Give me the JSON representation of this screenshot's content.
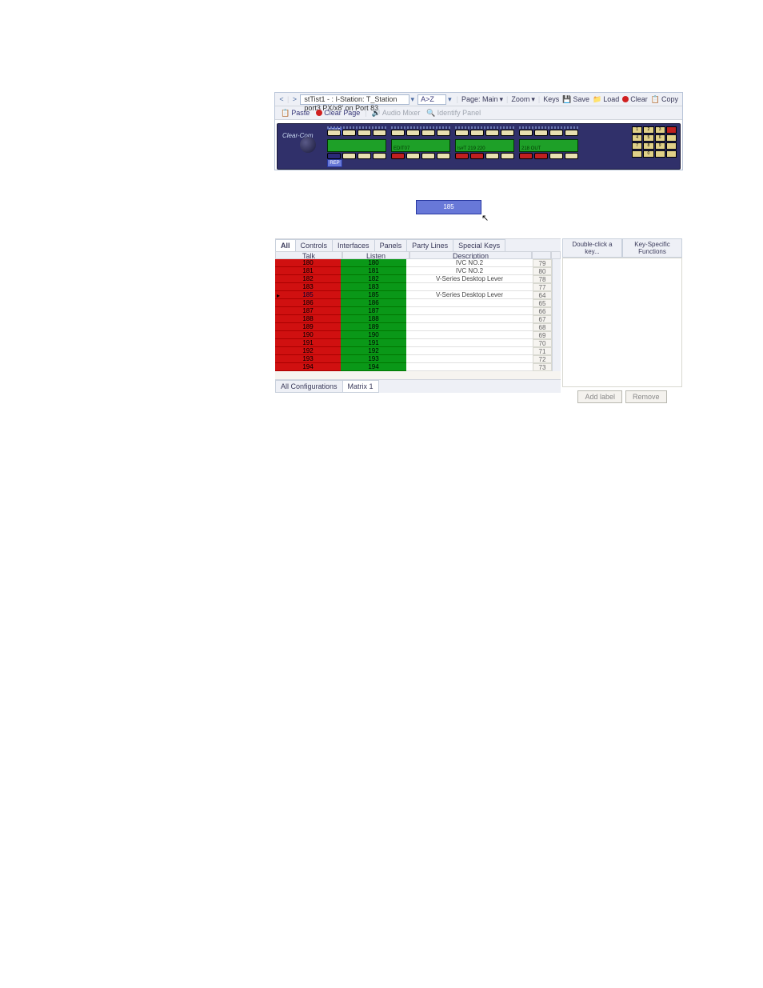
{
  "toolbar": {
    "path": "stTist1 - : I-Station: T_Station port3 PX/x8' on Port 83",
    "az": "A>Z",
    "page": "Page: Main",
    "zoom": "Zoom",
    "keys": "Keys",
    "save": "Save",
    "load": "Load",
    "clear": "Clear",
    "copy": "Copy"
  },
  "toolbar2": {
    "paste": "Paste",
    "clearpage": "Clear Page",
    "audiomixer": "Audio Mixer",
    "identify": "Identify Panel"
  },
  "device": {
    "brand": "Clear-Com",
    "btn185": "185",
    "edit": "EDIT",
    "rep": "REP",
    "lcd3": "ls#T        219    220",
    "lcd4": "218    OUT",
    "lcd2": "EDIT07"
  },
  "tabs": [
    "All",
    "Controls",
    "Interfaces",
    "Panels",
    "Party Lines",
    "Special Keys"
  ],
  "columns": {
    "talk": "Talk",
    "listen": "Listen",
    "desc": "Description"
  },
  "rows": [
    {
      "t": "180",
      "l": "180",
      "d": "IVC NO.2",
      "n": "79"
    },
    {
      "t": "181",
      "l": "181",
      "d": "IVC NO.2",
      "n": "80"
    },
    {
      "t": "182",
      "l": "182",
      "d": "V-Series Desktop Lever",
      "n": "78"
    },
    {
      "t": "183",
      "l": "183",
      "d": "",
      "n": "77"
    },
    {
      "t": "185",
      "l": "185",
      "d": "V-Series Desktop Lever",
      "n": "64",
      "sel": true
    },
    {
      "t": "186",
      "l": "186",
      "d": "",
      "n": "65"
    },
    {
      "t": "187",
      "l": "187",
      "d": "",
      "n": "66"
    },
    {
      "t": "188",
      "l": "188",
      "d": "",
      "n": "67"
    },
    {
      "t": "189",
      "l": "189",
      "d": "",
      "n": "68"
    },
    {
      "t": "190",
      "l": "190",
      "d": "",
      "n": "69"
    },
    {
      "t": "191",
      "l": "191",
      "d": "",
      "n": "70"
    },
    {
      "t": "192",
      "l": "192",
      "d": "",
      "n": "71"
    },
    {
      "t": "193",
      "l": "193",
      "d": "",
      "n": "72"
    },
    {
      "t": "194",
      "l": "194",
      "d": "",
      "n": "73"
    }
  ],
  "bottomtabs": [
    "All Configurations",
    "Matrix 1"
  ],
  "rpanel": {
    "t1": "Double-click a key...",
    "t2": "Key-Specific Functions",
    "add": "Add label",
    "remove": "Remove"
  }
}
